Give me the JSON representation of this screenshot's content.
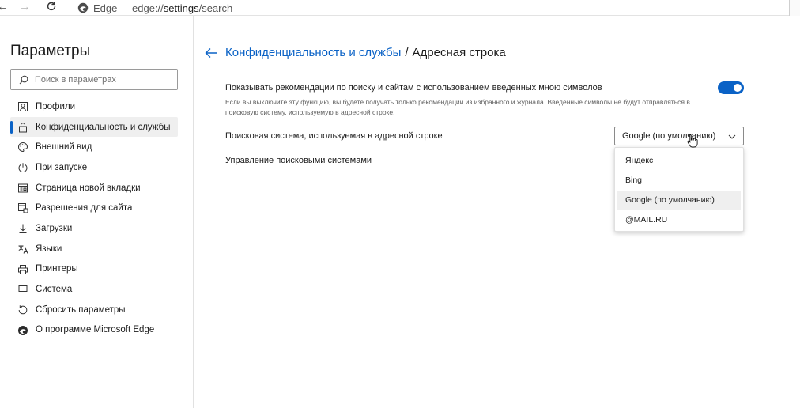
{
  "browser": {
    "app_name": "Edge",
    "url_prefix": "edge://",
    "url_main": "settings",
    "url_suffix": "/search"
  },
  "sidebar": {
    "title": "Параметры",
    "search_placeholder": "Поиск в параметрах",
    "items": [
      {
        "label": "Профили",
        "icon": "profile-icon"
      },
      {
        "label": "Конфиденциальность и службы",
        "icon": "lock-icon",
        "active": true
      },
      {
        "label": "Внешний вид",
        "icon": "palette-icon"
      },
      {
        "label": "При запуске",
        "icon": "power-icon"
      },
      {
        "label": "Страница новой вкладки",
        "icon": "new-tab-icon"
      },
      {
        "label": "Разрешения для сайта",
        "icon": "site-permissions-icon"
      },
      {
        "label": "Загрузки",
        "icon": "download-icon"
      },
      {
        "label": "Языки",
        "icon": "languages-icon"
      },
      {
        "label": "Принтеры",
        "icon": "printer-icon"
      },
      {
        "label": "Система",
        "icon": "system-icon"
      },
      {
        "label": "Сбросить параметры",
        "icon": "reset-icon"
      },
      {
        "label": "О программе Microsoft Edge",
        "icon": "edge-logo-icon"
      }
    ]
  },
  "main": {
    "breadcrumb_parent": "Конфиденциальность и службы",
    "breadcrumb_separator": "/",
    "breadcrumb_current": "Адресная строка",
    "suggestions_title": "Показывать рекомендации по поиску и сайтам с использованием введенных мною символов",
    "suggestions_desc": "Если вы выключите эту функцию, вы будете получать только рекомендации из избранного и журнала. Введенные символы не будут отправляться в поисковую систему, используемую в адресной строке.",
    "suggestions_enabled": true,
    "search_engine_label": "Поисковая система, используемая в адресной строке",
    "search_engine_value": "Google (по умолчанию)",
    "manage_engines_label": "Управление поисковыми системами",
    "dropdown_options": [
      "Яндекс",
      "Bing",
      "Google (по умолчанию)",
      "@MAIL.RU"
    ],
    "dropdown_selected_index": 2
  },
  "colors": {
    "accent": "#0a62c6",
    "selected_bg": "#efefef"
  }
}
